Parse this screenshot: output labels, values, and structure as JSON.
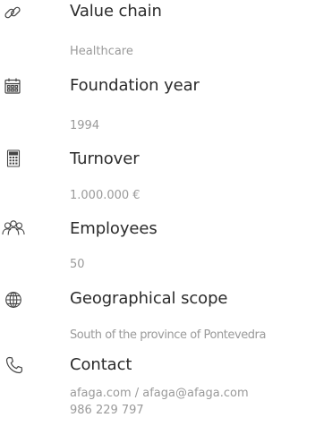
{
  "items": [
    {
      "icon": "link-icon",
      "title": "Value chain",
      "lines": [
        "Healthcare"
      ]
    },
    {
      "icon": "calendar-icon",
      "title": "Foundation year",
      "lines": [
        "1994"
      ]
    },
    {
      "icon": "calculator-icon",
      "title": "Turnover",
      "lines": [
        "1.000.000 €"
      ]
    },
    {
      "icon": "people-icon",
      "title": "Employees",
      "lines": [
        "50"
      ]
    },
    {
      "icon": "globe-icon",
      "title": "Geographical scope",
      "lines": [
        "South of the province of Pontevedra"
      ]
    },
    {
      "icon": "phone-icon",
      "title": "Contact",
      "lines": [
        "afaga.com / afaga@afaga.com",
        "986 229 797"
      ]
    }
  ],
  "colors": {
    "title": "#2b2b2b",
    "subtitle": "#9a9a9a",
    "icon": "#444444"
  }
}
